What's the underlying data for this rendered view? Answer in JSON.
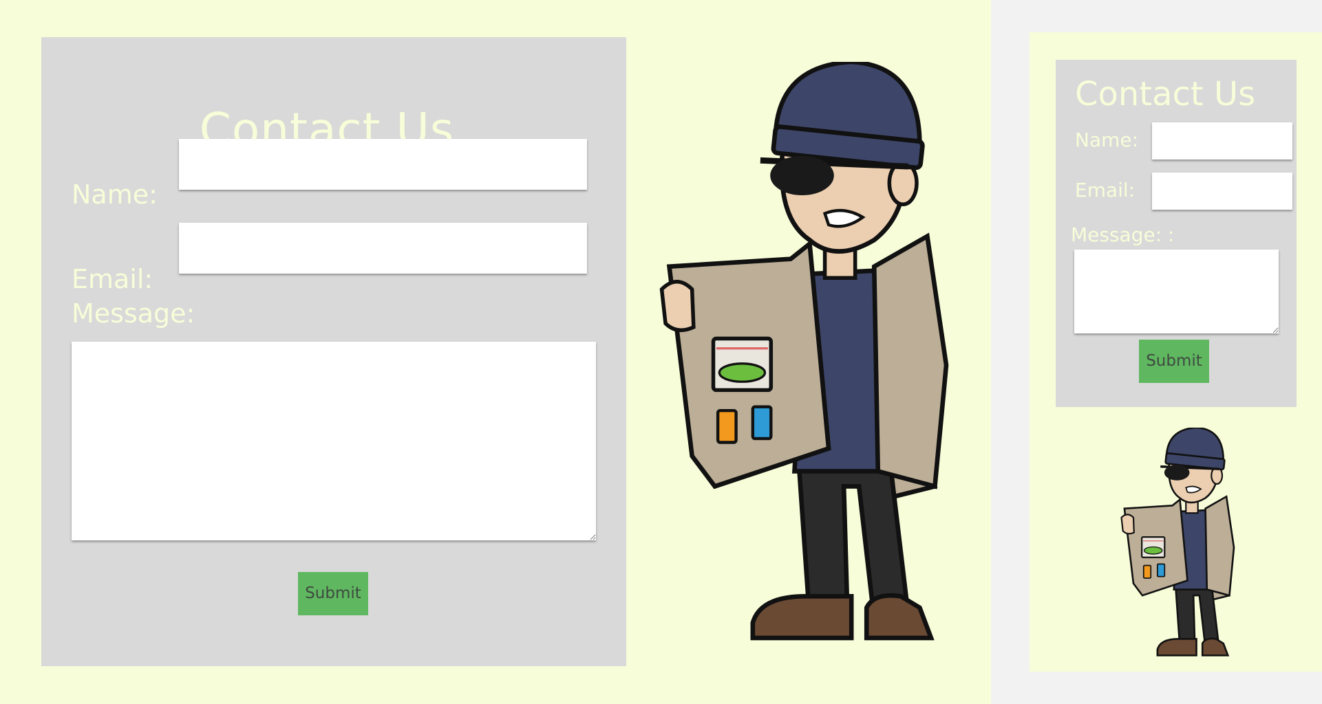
{
  "desktop": {
    "title": "Contact Us",
    "name_label": "Name:",
    "email_label": "Email:",
    "message_label": "Message:",
    "submit_label": "Submit",
    "name_value": "",
    "email_value": "",
    "message_value": ""
  },
  "mobile": {
    "title": "Contact Us",
    "name_label": "Name:",
    "email_label": "Email:",
    "message_label": "Message: :",
    "submit_label": "Submit",
    "name_value": "",
    "email_value": "",
    "message_value": ""
  },
  "colors": {
    "page_background": "#f8fdd9",
    "card_background": "#d9d9d9",
    "label_text": "#f8fdd9",
    "submit_background": "#5fb760",
    "outer_background": "#f2f2f2"
  },
  "illustration": {
    "name": "trenchcoat-dealer-illustration"
  }
}
